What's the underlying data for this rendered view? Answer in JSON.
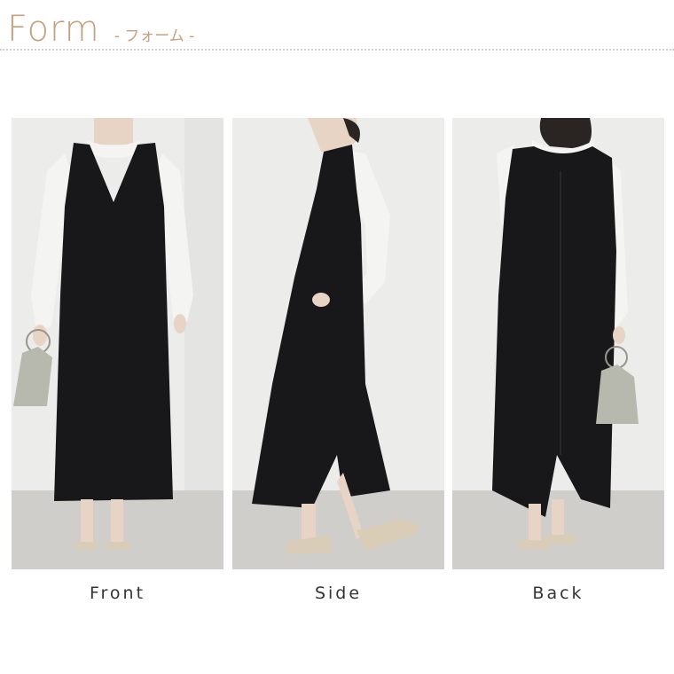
{
  "header": {
    "title": "Form",
    "subtitle": "- フォーム -"
  },
  "views": [
    {
      "label": "Front"
    },
    {
      "label": "Side"
    },
    {
      "label": "Back"
    }
  ],
  "colors": {
    "accent": "#c6a07c",
    "dress": "#18181a",
    "shirt": "#f4f4f2",
    "wall": "#ececeb",
    "floor": "#cfcecb"
  }
}
